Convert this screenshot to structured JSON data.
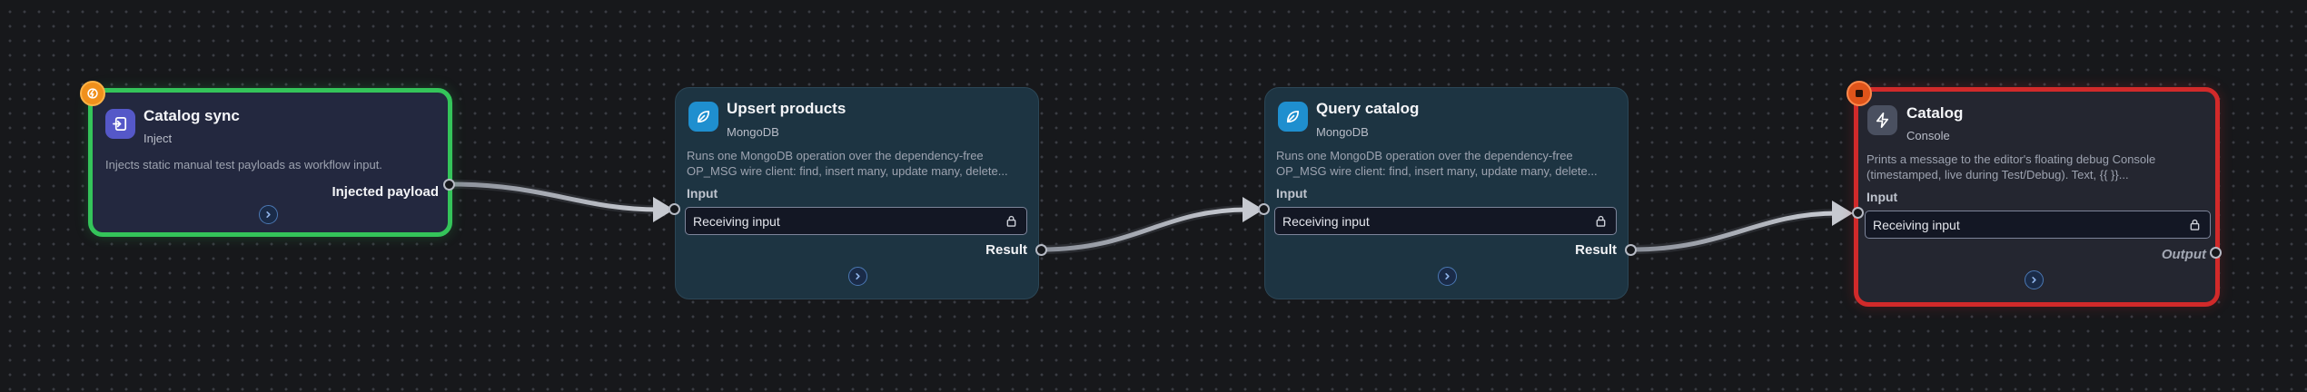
{
  "colors": {
    "canvas_bg": "#17181b",
    "inject_border": "#34c45a",
    "console_border": "#d12a2a",
    "mongo_bg": "#1d3442",
    "trigger_badge": "#f0901c",
    "stop_badge": "#e0541a"
  },
  "nodes": [
    {
      "id": "catalog-sync",
      "title": "Catalog sync",
      "type_label": "Inject",
      "description": "Injects static manual test payloads as workflow input.",
      "output_label": "Injected payload",
      "icon": "inject-icon",
      "badge_icon": "lightning-icon"
    },
    {
      "id": "upsert-products",
      "title": "Upsert products",
      "type_label": "MongoDB",
      "description": "Runs one MongoDB operation over the dependency-free OP_MSG wire client: find, insert many, update many, delete...",
      "input_section": "Input",
      "input_value": "Receiving input",
      "output_label": "Result",
      "icon": "leaf-icon"
    },
    {
      "id": "query-catalog",
      "title": "Query catalog",
      "type_label": "MongoDB",
      "description": "Runs one MongoDB operation over the dependency-free OP_MSG wire client: find, insert many, update many, delete...",
      "input_section": "Input",
      "input_value": "Receiving input",
      "output_label": "Result",
      "icon": "leaf-icon"
    },
    {
      "id": "catalog-console",
      "title": "Catalog",
      "type_label": "Console",
      "description": "Prints a message to the editor's floating debug Console (timestamped, live during Test/Debug). Text, {{ }}...",
      "input_section": "Input",
      "input_value": "Receiving input",
      "output_label": "Output",
      "icon": "lightning-icon",
      "badge_icon": "stop-icon"
    }
  ]
}
